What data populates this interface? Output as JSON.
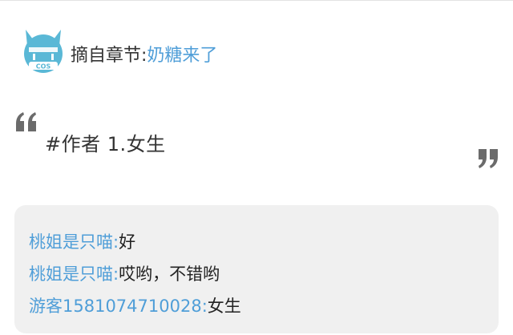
{
  "header": {
    "avatar_icon": "cat-cos-avatar-icon",
    "avatar_label": "COS",
    "chapter_prefix": "摘自章节:",
    "chapter_title": "奶糖来了"
  },
  "quote": {
    "open_icon": "quote-open-icon",
    "close_icon": "quote-close-icon",
    "text": "#作者 1.女生"
  },
  "comments": [
    {
      "user": "桃姐是只喵:",
      "text": "好"
    },
    {
      "user": "桃姐是只喵:",
      "text": "哎哟，不错哟"
    },
    {
      "user": "游客1581074710028:",
      "text": "女生"
    }
  ],
  "colors": {
    "link": "#4f9ed8",
    "avatar": "#5ab8d6",
    "quote_mark": "#6b6b6b",
    "comment_bg": "#f0f0f0"
  }
}
